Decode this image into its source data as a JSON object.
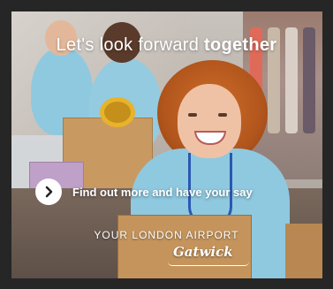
{
  "ad": {
    "headline_prefix": "Let's look forward ",
    "headline_strong": "together",
    "cta_label": "Find out more and have your say",
    "tagline": "YOUR LONDON AIRPORT",
    "brand": "Gatwick"
  },
  "colors": {
    "text": "#ffffff",
    "cta_circle": "#ffffff",
    "cta_arrow": "#222222"
  },
  "icons": {
    "cta": "chevron-right-icon"
  }
}
